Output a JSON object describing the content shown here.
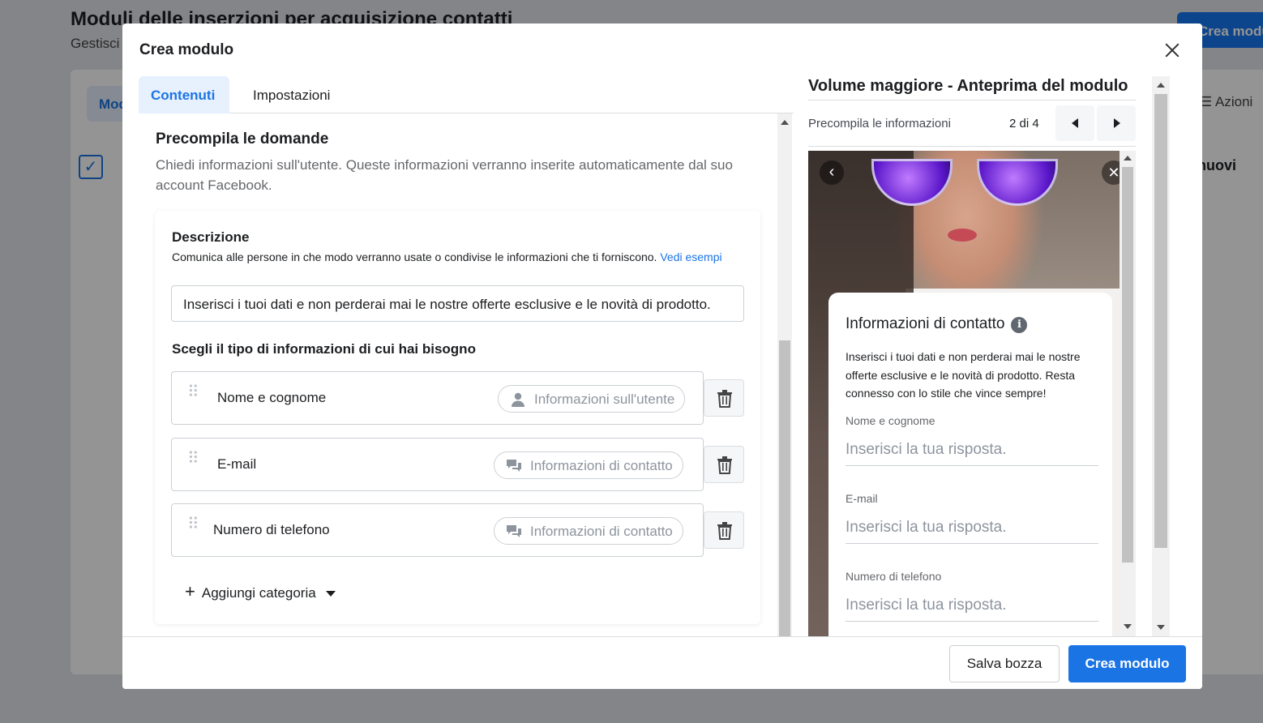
{
  "background": {
    "page_title": "Moduli delle inserzioni per acquisizione contatti",
    "page_subtitle": "Gestisci",
    "create_button": "Crea modulo",
    "tab": "Mod",
    "actions": "Azioni",
    "nuovi": "nuovi"
  },
  "modal": {
    "title": "Crea modulo",
    "tabs": [
      {
        "label": "Contenuti",
        "active": true
      },
      {
        "label": "Impostazioni",
        "active": false
      }
    ]
  },
  "prefill": {
    "title": "Precompila le domande",
    "description": "Chiedi informazioni sull'utente. Queste informazioni verranno inserite automaticamente dal suo account Facebook.",
    "desc_label": "Descrizione",
    "desc_help": "Comunica alle persone in che modo verranno usate o condivise le informazioni che ti forniscono.",
    "desc_help_link": "Vedi esempi",
    "desc_value": "Inserisci i tuoi dati e non perderai mai le nostre offerte esclusive e le novità di prodotto.",
    "type_label": "Scegli il tipo di informazioni di cui hai bisogno",
    "questions": [
      {
        "label": "Nome e cognome",
        "category": "Informazioni sull'utente",
        "icon": "user-icon"
      },
      {
        "label": "E-mail",
        "category": "Informazioni di contatto",
        "icon": "chat-bubbles-icon"
      },
      {
        "label": "Numero di telefono",
        "category": "Informazioni di contatto",
        "icon": "chat-bubbles-icon"
      }
    ],
    "add_category": "Aggiungi categoria"
  },
  "preview": {
    "title": "Volume maggiore - Anteprima del modulo",
    "section": "Precompila le informazioni",
    "page_indicator": "2 di 4",
    "card_title": "Informazioni di contatto",
    "card_text": "Inserisci i tuoi dati e non perderai mai le nostre offerte esclusive e le novità di prodotto. Resta connesso con lo stile che vince sempre!",
    "fields": [
      {
        "label": "Nome e cognome",
        "placeholder": "Inserisci la tua risposta."
      },
      {
        "label": "E-mail",
        "placeholder": "Inserisci la tua risposta."
      },
      {
        "label": "Numero di telefono",
        "placeholder": "Inserisci la tua risposta."
      }
    ]
  },
  "footer": {
    "draft_button": "Salva bozza",
    "create_button": "Crea modulo"
  },
  "colors": {
    "accent": "#1b74e4",
    "tab_active_bg": "#e7f0fd"
  }
}
